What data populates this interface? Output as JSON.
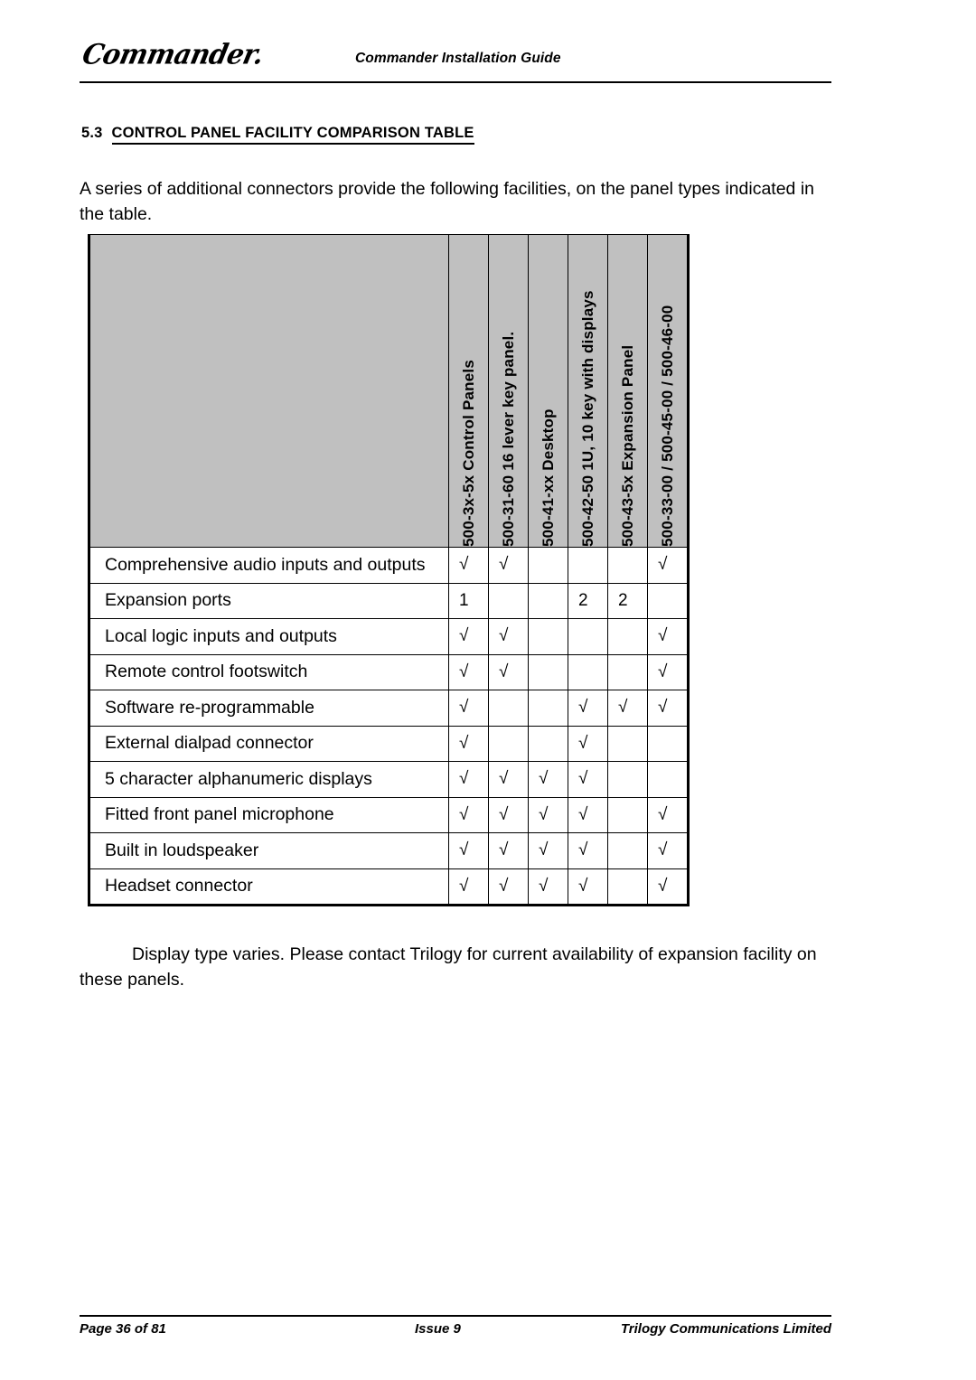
{
  "header": {
    "logo_text": "Commander.",
    "title": "Commander Installation Guide"
  },
  "section": {
    "number": "5.3",
    "title": "CONTROL PANEL FACILITY COMPARISON TABLE"
  },
  "intro_paragraph": "A series of additional connectors provide the following facilities, on the panel types indicated in the table.",
  "note_paragraph": "Display type varies. Please contact Trilogy for current availability of expansion facility on these panels.",
  "table": {
    "row_header_blank": "",
    "columns": [
      "500-3x-5x Control Panels",
      "500-31-60 16 lever key panel.",
      "500-41-xx Desktop",
      "500-42-50 1U, 10 key with displays",
      "500-43-5x Expansion Panel",
      "500-33-00 / 500-45-00 / 500-46-00"
    ],
    "check_mark": "√",
    "rows": [
      {
        "label": "Comprehensive audio inputs and outputs",
        "values": [
          "√",
          "√",
          "",
          "",
          "",
          "√"
        ]
      },
      {
        "label": "Expansion ports",
        "values": [
          "1",
          "",
          "",
          "2",
          "2",
          ""
        ]
      },
      {
        "label": "Local logic inputs and outputs",
        "values": [
          "√",
          "√",
          "",
          "",
          "",
          "√"
        ]
      },
      {
        "label": "Remote control footswitch",
        "values": [
          "√",
          "√",
          "",
          "",
          "",
          "√"
        ]
      },
      {
        "label": "Software re-programmable",
        "values": [
          "√",
          "",
          "",
          "√",
          "√",
          "√"
        ]
      },
      {
        "label": "External dialpad connector",
        "values": [
          "√",
          "",
          "",
          "√",
          "",
          ""
        ]
      },
      {
        "label": "5 character alphanumeric displays",
        "values": [
          "√",
          "√",
          "√",
          "√",
          "",
          ""
        ]
      },
      {
        "label": "Fitted front panel microphone",
        "values": [
          "√",
          "√",
          "√",
          "√",
          "",
          "√"
        ]
      },
      {
        "label": "Built in loudspeaker",
        "values": [
          "√",
          "√",
          "√",
          "√",
          "",
          "√"
        ]
      },
      {
        "label": "Headset connector",
        "values": [
          "√",
          "√",
          "√",
          "√",
          "",
          "√"
        ]
      }
    ]
  },
  "footer": {
    "page": "Page 36 of 81",
    "issue": "Issue 9",
    "company": "Trilogy Communications Limited"
  }
}
